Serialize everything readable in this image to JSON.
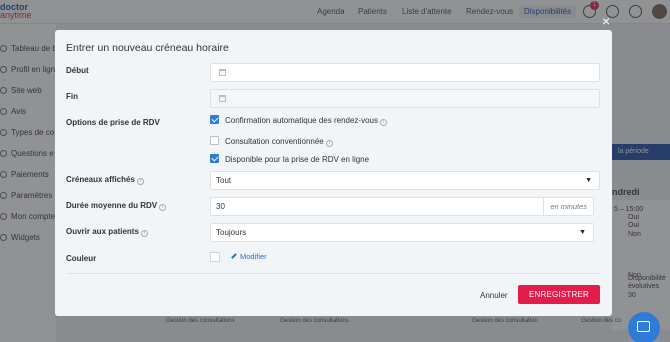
{
  "header": {
    "logo_line1": "doctor",
    "logo_line2": "anytime",
    "nav": [
      "Agenda",
      "Patients",
      "Liste d'attente",
      "Rendez-vous",
      "Disponibilités"
    ],
    "notification_count": "1"
  },
  "sidebar": {
    "items": [
      "Tableau de b",
      "Profil en lign",
      "Site web",
      "Avis",
      "Types de co",
      "Questions e",
      "Paiements",
      "Paramètres",
      "Mon compte",
      "Widgets"
    ]
  },
  "background": {
    "period_button": "la période",
    "day_header": "ndredi",
    "time_range": "5 – 15:00",
    "values": [
      "Oui",
      "Oui",
      "Non",
      "Non"
    ],
    "dispo_label": "Disponibilité évolutives",
    "dispo_value": "30",
    "bottom_labels": [
      "Gestion des consultations",
      "Gestion des consultations",
      "Gestion des consultation",
      "Gestion des co"
    ]
  },
  "modal": {
    "title": "Entrer un nouveau créneau horaire",
    "close_icon": "×",
    "fields": {
      "debut_label": "Début",
      "fin_label": "Fin",
      "options_label": "Options de prise de RDV",
      "creneaux_label": "Créneaux affichés",
      "creneaux_value": "Tout",
      "duree_label": "Durée moyenne du RDV",
      "duree_value": "30",
      "duree_suffix": "en minutes",
      "ouvrir_label": "Ouvrir aux patients",
      "ouvrir_value": "Toujours",
      "couleur_label": "Couleur",
      "modifier_label": "Modifier"
    },
    "options": [
      {
        "label": "Confirmation automatique des rendez-vous",
        "checked": true
      },
      {
        "label": "Consultation conventionnée",
        "checked": false
      },
      {
        "label": "Disponible pour la prise de RDV en ligne",
        "checked": true
      }
    ],
    "cancel_label": "Annuler",
    "save_label": "ENREGISTRER"
  },
  "colors": {
    "accent": "#2e7bd8",
    "save": "#e21d4a",
    "brand": "#1e5fb4"
  }
}
